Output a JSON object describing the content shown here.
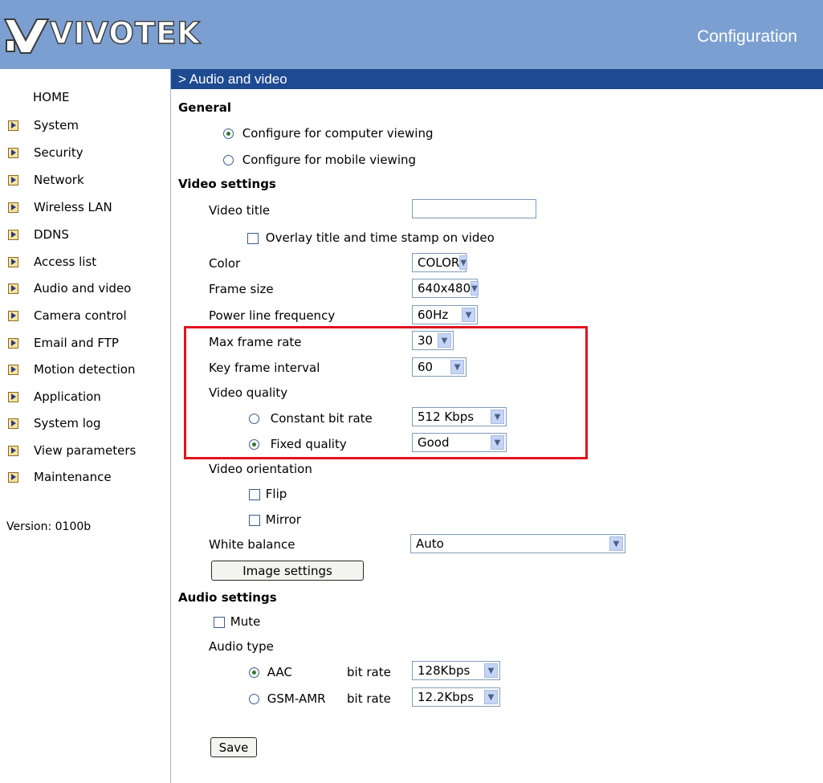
{
  "header": {
    "brand": "VIVOTEK",
    "title": "Configuration"
  },
  "sidebar": {
    "home": "HOME",
    "items": [
      "System",
      "Security",
      "Network",
      "Wireless LAN",
      "DDNS",
      "Access list",
      "Audio and video",
      "Camera control",
      "Email and FTP",
      "Motion detection",
      "Application",
      "System log",
      "View parameters",
      "Maintenance"
    ],
    "version": "Version: 0100b"
  },
  "page": {
    "section": "> Audio and video"
  },
  "general": {
    "title": "General",
    "computer_viewing": "Configure for computer viewing",
    "mobile_viewing": "Configure for mobile viewing",
    "selected": "computer"
  },
  "video": {
    "title": "Video settings",
    "video_title_label": "Video title",
    "video_title_value": "",
    "overlay_label": "Overlay title and time stamp on video",
    "color_label": "Color",
    "color_value": "COLOR",
    "frame_size_label": "Frame size",
    "frame_size_value": "640x480",
    "power_line_label": "Power line frequency",
    "power_line_value": "60Hz",
    "max_frame_rate_label": "Max frame rate",
    "max_frame_rate_value": "30",
    "key_frame_label": "Key frame interval",
    "key_frame_value": "60",
    "quality_label": "Video quality",
    "constant_bit_rate_label": "Constant bit rate",
    "constant_bit_rate_value": "512 Kbps",
    "fixed_quality_label": "Fixed quality",
    "fixed_quality_value": "Good",
    "orientation_label": "Video orientation",
    "flip_label": "Flip",
    "mirror_label": "Mirror",
    "white_balance_label": "White balance",
    "white_balance_value": "Auto",
    "image_settings_button": "Image settings"
  },
  "audio": {
    "title": "Audio settings",
    "mute_label": "Mute",
    "audio_type_label": "Audio type",
    "aac_label": "AAC",
    "aac_bitrate_label": "bit rate",
    "aac_bitrate_value": "128Kbps",
    "gsm_label": "GSM-AMR",
    "gsm_bitrate_label": "bit rate",
    "gsm_bitrate_value": "12.2Kbps"
  },
  "save_button": "Save",
  "colors": {
    "header_bg": "#7a9fd0",
    "section_bar": "#1e4a92",
    "highlight": "#e0141c"
  },
  "icons": {
    "nav_arrow": "arrow-right-icon",
    "select_arrow": "chevron-down-icon"
  }
}
